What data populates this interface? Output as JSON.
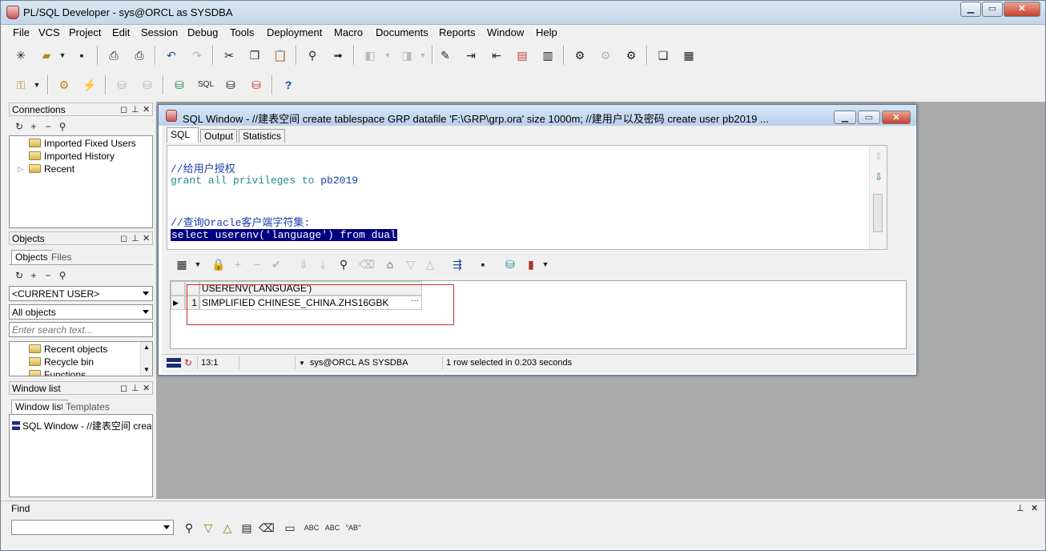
{
  "app": {
    "title": "PL/SQL Developer - sys@ORCL as SYSDBA"
  },
  "window_buttons": {
    "minimize": "▁",
    "restore": "▭",
    "close": "✕"
  },
  "menu": [
    "File",
    "VCS",
    "Project",
    "Edit",
    "Session",
    "Debug",
    "Tools",
    "Deployment",
    "Macro",
    "Documents",
    "Reports",
    "Window",
    "Help"
  ],
  "connections": {
    "title": "Connections",
    "items": [
      "Imported Fixed Users",
      "Imported History",
      "Recent"
    ]
  },
  "objects": {
    "title": "Objects",
    "tabs": [
      "Objects",
      "Files"
    ],
    "user_combo": "<CURRENT USER>",
    "filter_combo": "All objects",
    "search_placeholder": "Enter search text...",
    "tree": [
      "Recent objects",
      "Recycle bin",
      "Functions"
    ]
  },
  "window_list": {
    "title": "Window list",
    "tabs": [
      "Window list",
      "Templates"
    ],
    "items": [
      "SQL Window - //建表空间 create"
    ]
  },
  "sql_window": {
    "title": "SQL Window - //建表空间 create tablespace GRP datafile 'F:\\GRP\\grp.ora' size 1000m; //建用户以及密码 create user pb2019 ...",
    "tabs": [
      "SQL",
      "Output",
      "Statistics"
    ],
    "code": {
      "line1": "//给用户授权",
      "line2_kw": "grant all privileges to ",
      "line2_id": "pb2019",
      "line3": "//查询Oracle客户端字符集:",
      "line4": "select userenv('language') from dual"
    },
    "grid": {
      "column": "USERENV('LANGUAGE')",
      "row_num": "1",
      "value": "SIMPLIFIED CHINESE_CHINA.ZHS16GBK",
      "ellipsis": "···"
    },
    "status": {
      "position": "13:1",
      "connection": "sys@ORCL AS SYSDBA",
      "message": "1 row selected in 0.203 seconds"
    }
  },
  "find": {
    "title": "Find",
    "input_value": ""
  },
  "colors": {
    "selection": "#000080",
    "comment": "#1a3fa8",
    "keyword": "#1f8c8c",
    "highlight_box": "#d03030"
  }
}
